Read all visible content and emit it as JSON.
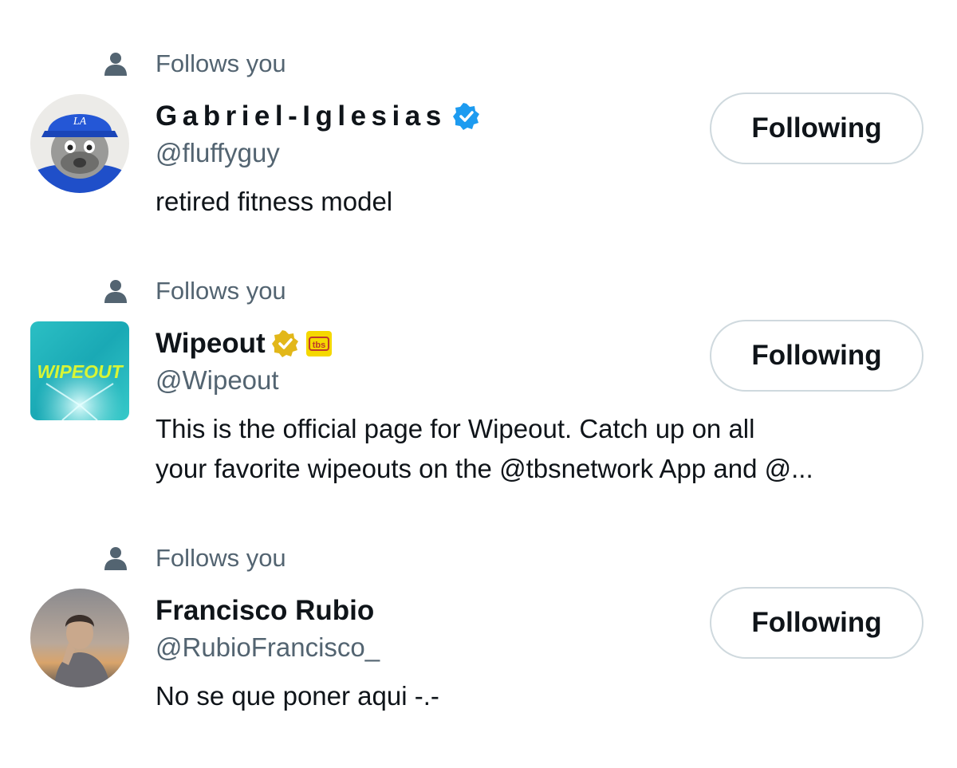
{
  "users": [
    {
      "social_context": "Follows you",
      "display_name": "Gabriel-Iglesias",
      "handle": "@fluffyguy",
      "badge": "verified-blue-check-icon",
      "bio_lines": [
        "retired fitness model"
      ],
      "follow_button": "Following"
    },
    {
      "social_context": "Follows you",
      "display_name": "Wipeout",
      "handle": "@Wipeout",
      "badge": "verified-gold-check-icon",
      "affiliate_badge": "tbs",
      "avatar_text": "WIPEOUT",
      "bio_lines": [
        "This is the official page for Wipeout. Catch up on all",
        "your favorite wipeouts on the @tbsnetwork App and @..."
      ],
      "follow_button": "Following"
    },
    {
      "social_context": "Follows you",
      "display_name": "Francisco Rubio",
      "handle": "@RubioFrancisco_",
      "bio_lines": [
        "No se que poner aqui -.-"
      ],
      "follow_button": "Following"
    }
  ],
  "colors": {
    "primary_text": "#0f1419",
    "secondary_text": "#536471",
    "button_border": "#cfd9de",
    "verified_blue": "#1d9bf0",
    "verified_gold": "#e2b719"
  }
}
